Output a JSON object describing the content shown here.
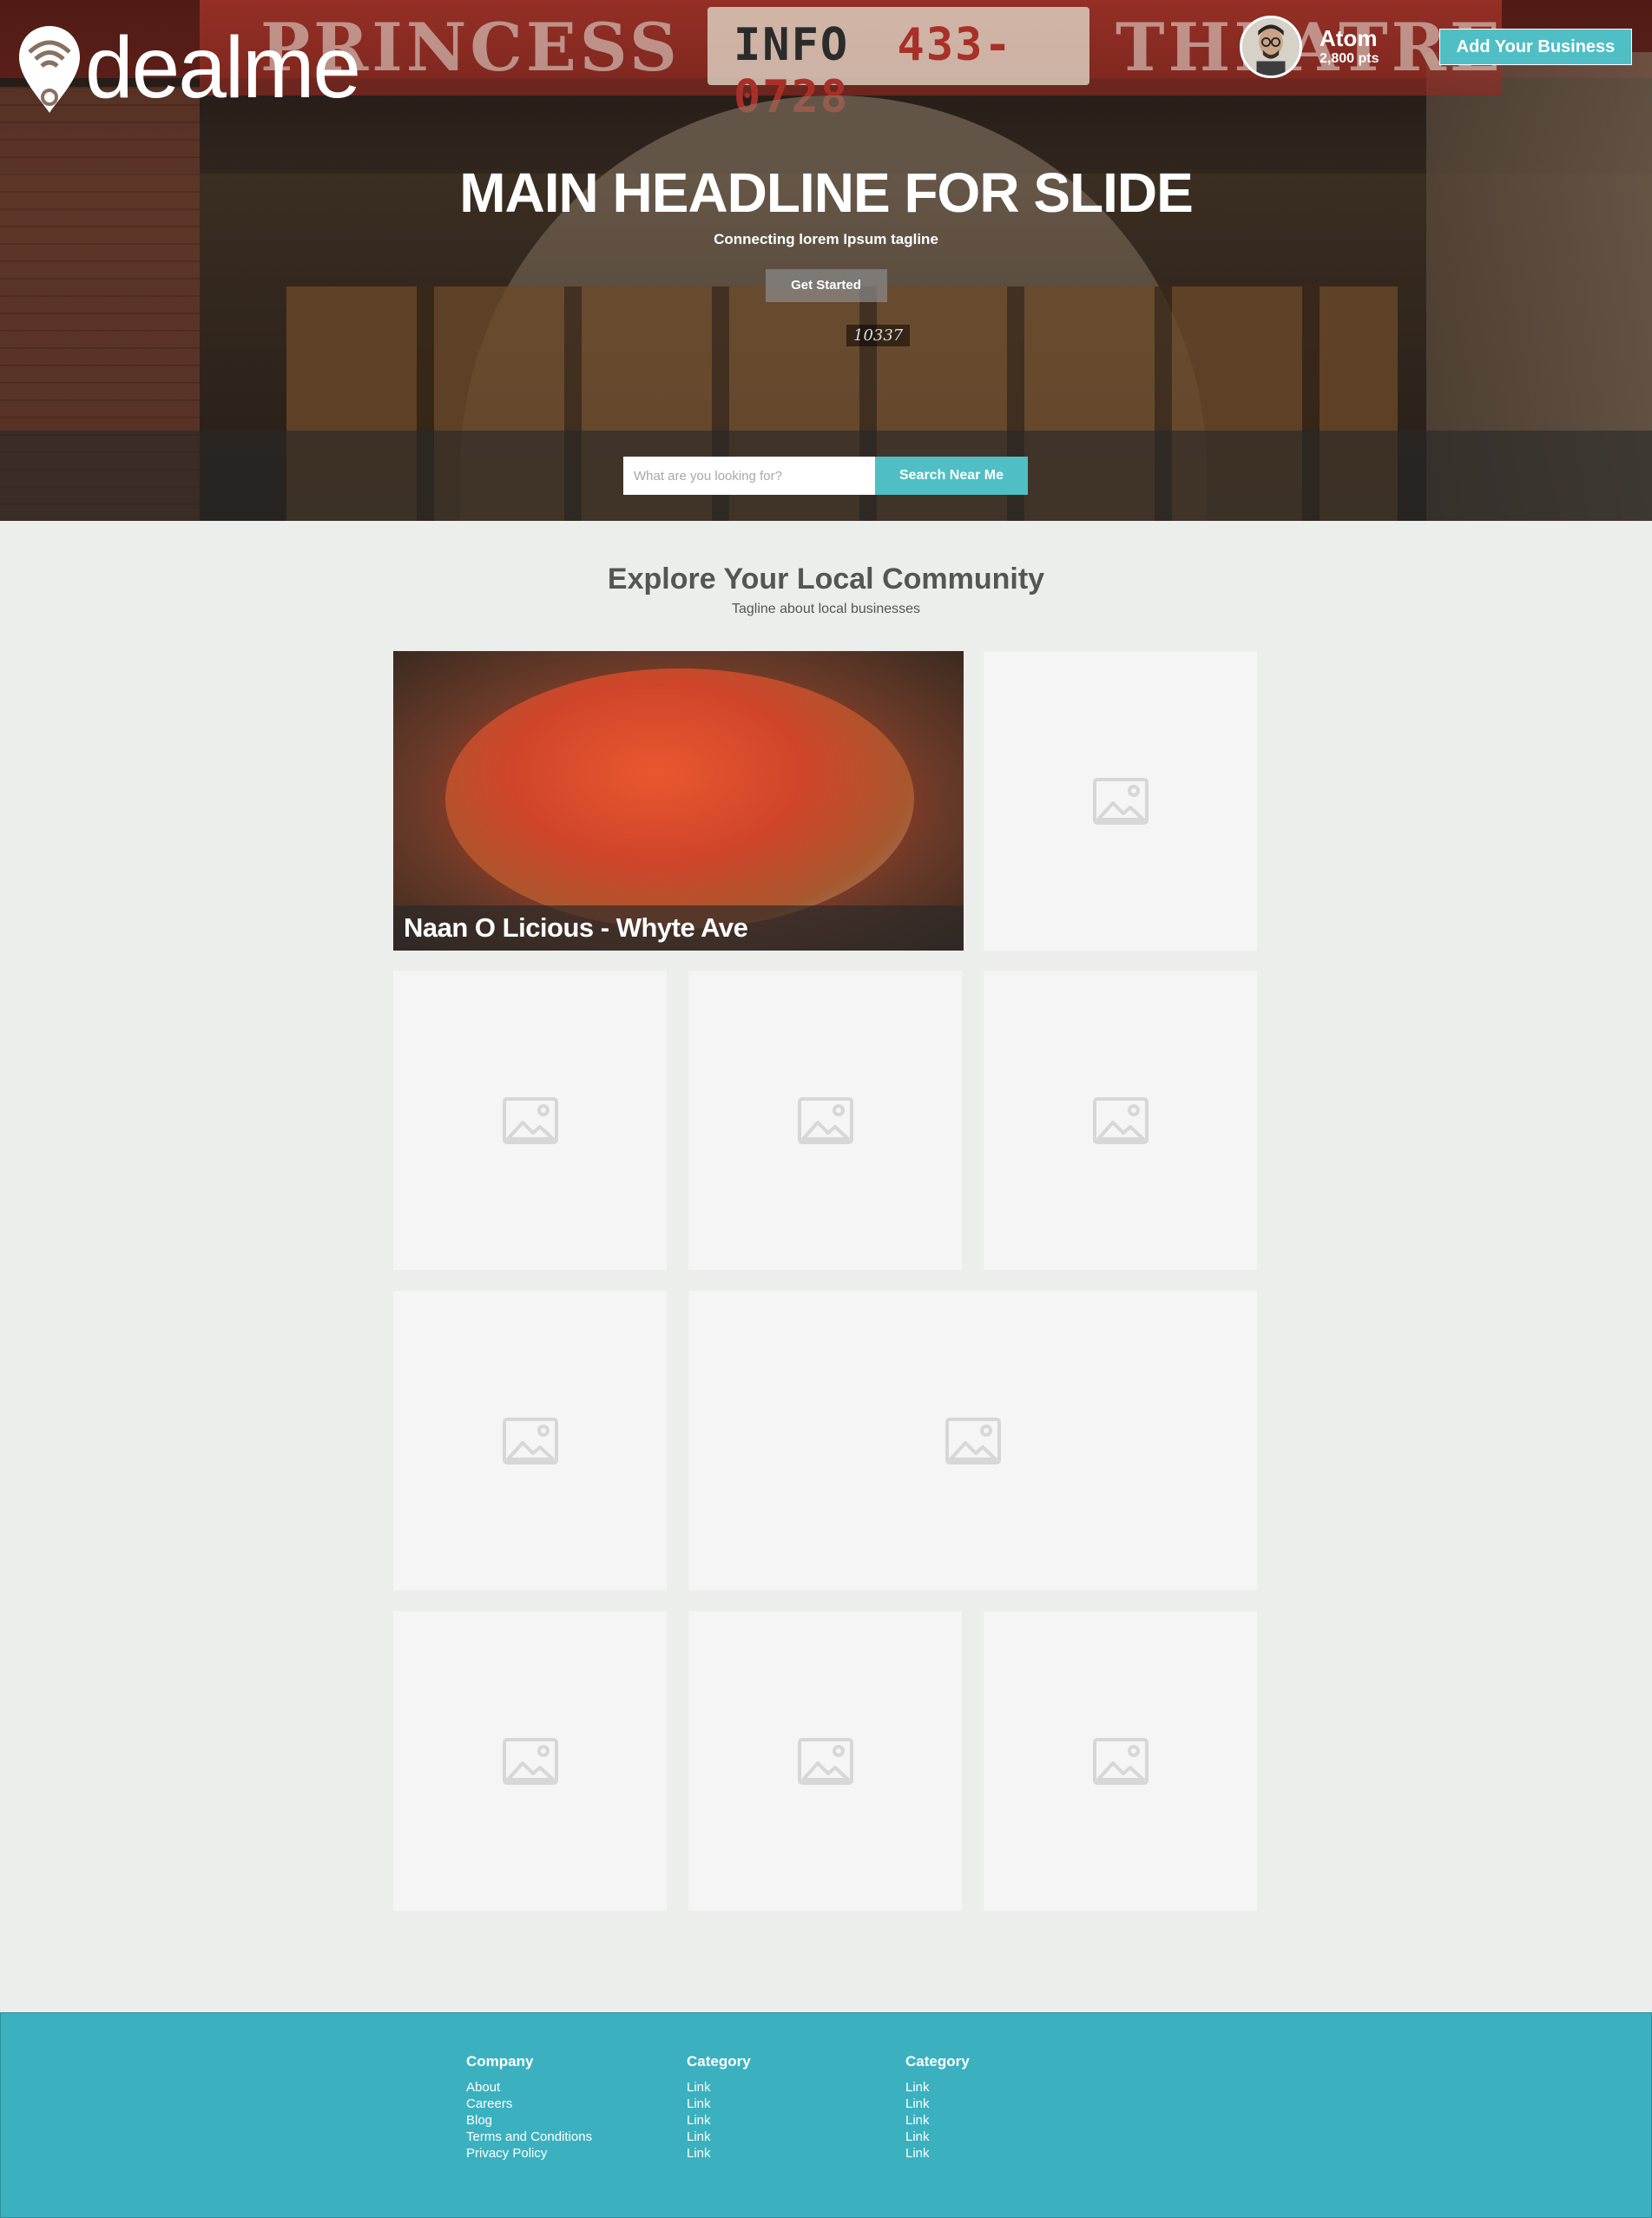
{
  "header": {
    "logo_text": "dealme",
    "user": {
      "name": "Atom",
      "points": "2,800 pts"
    },
    "add_business_label": "Add Your Business"
  },
  "hero": {
    "marquee_left": "PRINCESS",
    "marquee_right": "THEATRE",
    "info_label": "INFO",
    "info_phone": "433-0728",
    "door_number": "10337",
    "headline": "MAIN HEADLINE FOR SLIDE",
    "tagline": "Connecting lorem Ipsum tagline",
    "cta_label": "Get Started"
  },
  "search": {
    "placeholder": "What are you looking for?",
    "value": "",
    "button_label": "Search Near Me"
  },
  "explore": {
    "title": "Explore Your Local Community",
    "tagline": "Tagline about local businesses",
    "featured_caption": "Naan O Licious - Whyte Ave",
    "placeholder_icon": "image-placeholder-icon"
  },
  "footer": {
    "columns": [
      {
        "title": "Company",
        "links": [
          "About",
          "Careers",
          "Blog",
          "Terms and Conditions",
          "Privacy Policy"
        ]
      },
      {
        "title": "Category",
        "links": [
          "Link",
          "Link",
          "Link",
          "Link",
          "Link"
        ]
      },
      {
        "title": "Category",
        "links": [
          "Link",
          "Link",
          "Link",
          "Link",
          "Link"
        ]
      }
    ]
  },
  "colors": {
    "accent": "#4fbfc5",
    "footer": "#3bb1c0",
    "page_bg": "#eceeeb",
    "tile_bg": "#f4f5f4"
  }
}
